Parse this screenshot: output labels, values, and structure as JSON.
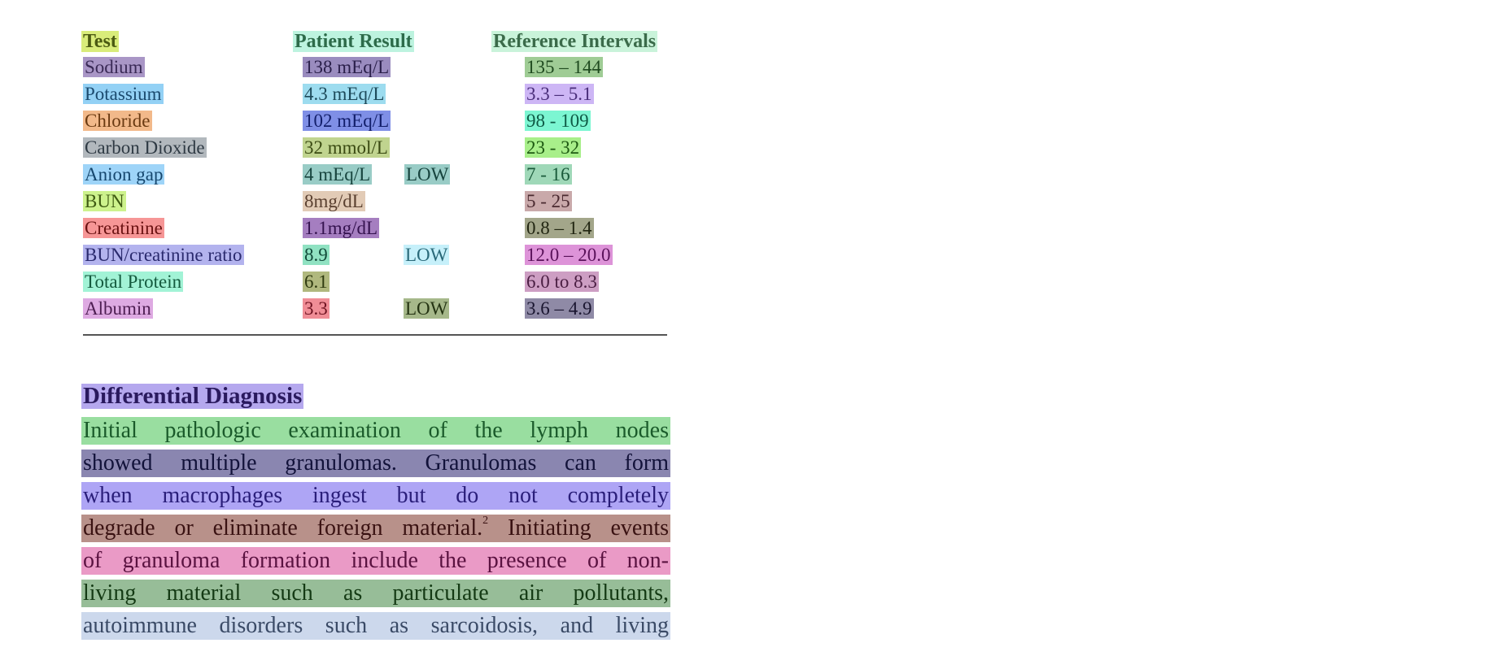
{
  "table": {
    "headers": [
      {
        "text": "Test",
        "bg": "#d9ec7a",
        "fg": "#4b5a12",
        "box": "#d2cf55"
      },
      {
        "text": "Patient Result",
        "bg": "#bdf3df",
        "fg": "#2d6b4a",
        "box": "#9fe2de"
      },
      {
        "text": "Reference Intervals",
        "bg": "#c9f3da",
        "fg": "#3b6b4a",
        "box": "#a4e6c3"
      }
    ],
    "rows": [
      {
        "test": {
          "text": "Sodium",
          "bg": "#a996c6",
          "fg": "#3a2a56",
          "box": "#5a3f7a"
        },
        "result": {
          "text": "138 mEq/L",
          "bg": "#9a8cbf",
          "fg": "#2a1f4a",
          "box": "#4a3a6a"
        },
        "flag": null,
        "ref": {
          "text": "135 – 144",
          "bg": "#9fcc95",
          "fg": "#1f4a1f",
          "box": "#4a8a4a"
        },
        "ocr": {
          "test": "Sodium",
          "result": "138 mEq/L",
          "ref": "135 - 144"
        }
      },
      {
        "test": {
          "text": "Potassium",
          "bg": "#93d1f5",
          "fg": "#1b4a6e",
          "box": "#3aa0c8"
        },
        "result": {
          "text": "4.3 mEq/L",
          "bg": "#9ddcef",
          "fg": "#1d4a5a",
          "box": "#56aec6"
        },
        "flag": null,
        "ref": {
          "text": "3.3 – 5.1",
          "bg": "#cdb6f5",
          "fg": "#4a2e7a",
          "box": "#a170d0"
        },
        "ocr": {
          "test": "Potassium",
          "result": "4.3 mEq/L",
          "ref": "3.3 -- 5.1"
        }
      },
      {
        "test": {
          "text": "Chloride",
          "bg": "#f2b98a",
          "fg": "#6a3a12",
          "box": "#d09040"
        },
        "result": {
          "text": "102 mEq/L",
          "bg": "#7f8fe6",
          "fg": "#121e6a",
          "box": "#203a90"
        },
        "flag": null,
        "ref": {
          "text": "98 - 109",
          "bg": "#7cf6d2",
          "fg": "#0e5a45",
          "box": "#4ad8c8"
        },
        "ocr": {
          "test": "Chloride",
          "result": "102 mEq/L",
          "ref": "98 - 109"
        }
      },
      {
        "test": {
          "text": "Carbon Dioxide",
          "bg": "#b2b8bd",
          "fg": "#2f3a44",
          "box": "#555f66"
        },
        "result": {
          "text": "32 mmol/L",
          "bg": "#c0d48f",
          "fg": "#3a4a12",
          "box": "#8aa040"
        },
        "flag": null,
        "ref": {
          "text": "23 - 32",
          "bg": "#a8ef8a",
          "fg": "#1e5a12",
          "box": "#6ac860"
        },
        "ocr": {
          "test": "Carbon Dioxide",
          "result": "32 mmol/L",
          "ref": "23 - 32"
        }
      },
      {
        "test": {
          "text": "Anion gap",
          "bg": "#9ed4f8",
          "fg": "#16476e",
          "box": "#4aa6d8"
        },
        "result": {
          "text": "4  mEq/L",
          "bg": "#99ccc6",
          "fg": "#17443e",
          "box": "#3a8a8a"
        },
        "flag": {
          "text": "LOW",
          "bg": "#99ccc6",
          "fg": "#17443e"
        },
        "ref": {
          "text": "7 - 16",
          "bg": "#9fd8b8",
          "fg": "#1a5a3a",
          "box": "#4a9a6a"
        },
        "ocr": {
          "test": "Anion gap",
          "result": "4 mEq/L LOW",
          "ref": "7 -16"
        }
      },
      {
        "test": {
          "text": "BUN",
          "bg": "#cdf28d",
          "fg": "#3e5a12",
          "box": "#9ccc55"
        },
        "result": {
          "text": "8mg/dL",
          "bg": "#e2cbb6",
          "fg": "#5a4030",
          "box": "#bfa284"
        },
        "flag": null,
        "ref": {
          "text": "5 - 25",
          "bg": "#c9a9aa",
          "fg": "#4a2a30",
          "box": "#8a5a70"
        },
        "ocr": {
          "test": "BUN",
          "result": "8mg/dL",
          "ref": "5 - 25"
        }
      },
      {
        "test": {
          "text": "Creatinine",
          "bg": "#f69696",
          "fg": "#6a1212",
          "box": "#c83a3a"
        },
        "result": {
          "text": "1.1mg/dL",
          "bg": "#a57ec0",
          "fg": "#34124e",
          "box": "#5a1a7a"
        },
        "flag": null,
        "ref": {
          "text": "0.8 – 1.4",
          "bg": "#a3a68a",
          "fg": "#222612",
          "box": "#4a4a1a"
        },
        "ocr": {
          "test": "Creatinine",
          "result": "1.1mg/dL",
          "ref": "0.8 - 1.4"
        }
      },
      {
        "test": {
          "text": "BUN/creatinine ratio",
          "bg": "#b3b3ee",
          "fg": "#2a2a6e",
          "box": "#7a6ab8"
        },
        "result": {
          "text": "8.9",
          "bg": "#90e2c2",
          "fg": "#124a3a",
          "box": "#40b0a0"
        },
        "flag": {
          "text": "LOW",
          "bg": "#c6f0fa",
          "fg": "#2a6a7a",
          "box": "#8ad8ea"
        },
        "ref": {
          "text": "12.0 – 20.0",
          "bg": "#dd93d8",
          "fg": "#5a125a",
          "box": "#9a4a9a"
        },
        "ocr": {
          "test": "BUN/creatinine ratio",
          "result": "8.9",
          "flag": "LOW",
          "ref": "12.0 - 20.0"
        }
      },
      {
        "test": {
          "text": "Total Protein",
          "bg": "#a2f3d6",
          "fg": "#145a3e",
          "box": "#50d0b8"
        },
        "result": {
          "text": "6.1",
          "bg": "#b0b87e",
          "fg": "#2f3a10",
          "box": "#6a6a2a"
        },
        "flag": null,
        "ref": {
          "text": "6.0 to 8.3",
          "bg": "#cd9ec3",
          "fg": "#4a1e42",
          "box": "#8a4a8a"
        },
        "ocr": {
          "test": "Total Protein",
          "result": "6.1",
          "ref": "6.0 to 8.3"
        }
      },
      {
        "test": {
          "text": "Albumin",
          "bg": "#deaae2",
          "fg": "#4e1e52",
          "box": "#b070c0"
        },
        "result": {
          "text": "3.3",
          "bg": "#f08d96",
          "fg": "#6e1220",
          "box": "#c03a4a"
        },
        "flag": {
          "text": "LOW",
          "bg": "#a6b88a",
          "fg": "#243312",
          "box": "#4a6a2a"
        },
        "ref": {
          "text": "3.6 – 4.9",
          "bg": "#8f8aa6",
          "fg": "#1a1630",
          "box": "#1a1a3a"
        },
        "ocr": {
          "test": "Albumin",
          "result": "3.3",
          "flag": "LOW",
          "ref": "3.6 - 4.9"
        }
      }
    ]
  },
  "section": {
    "title": {
      "text": "Differential Diagnosis",
      "bg": "#b5a8ee",
      "fg": "#2a1a5e",
      "box": "#6a5aa8"
    },
    "lines": [
      {
        "text": "Initial pathologic examination of the lymph nodes",
        "bg": "#99dea0",
        "fg": "#1a5a2a",
        "box": "#4a9a5a"
      },
      {
        "text": "showed multiple granulomas. Granulomas can form",
        "bg": "#8a86b0",
        "fg": "#12123a",
        "box": "#1a1a3a"
      },
      {
        "text": "when macrophages ingest but do not completely",
        "bg": "#aea5f5",
        "fg": "#2a1e7a",
        "box": "#6a5ab0"
      },
      {
        "text": "degrade or eliminate foreign material.",
        "sup": "2",
        "text_after": " Initiating events",
        "bg": "#b8918a",
        "fg": "#3a1212",
        "box": "#4a2a1a",
        "ocr": "degrade or eliminate foreign material. Initiating events"
      },
      {
        "text": "of granuloma formation include the presence of non-",
        "bg": "#ea9ac6",
        "fg": "#5a1240",
        "box": "#c060a0"
      },
      {
        "text": "living material such as particulate air pollutants,",
        "bg": "#97bd98",
        "fg": "#143a14",
        "box": "#3a6a3a"
      },
      {
        "text": "autoimmune disorders such as sarcoidosis, and living",
        "bg": "#ccd8ec",
        "fg": "#3a4a66",
        "box": "#a0b4cc"
      }
    ]
  }
}
